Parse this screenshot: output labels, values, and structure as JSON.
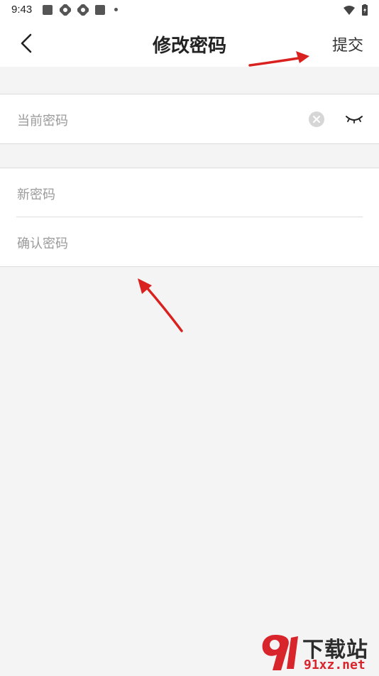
{
  "status_bar": {
    "time": "9:43"
  },
  "header": {
    "back_icon": "chevron-left-icon",
    "title": "修改密码",
    "submit_label": "提交"
  },
  "current_password_field": {
    "placeholder": "当前密码",
    "clear_icon": "clear-circle-icon",
    "visibility_icon": "eye-closed-icon"
  },
  "new_password_fields": [
    {
      "placeholder": "新密码"
    },
    {
      "placeholder": "确认密码"
    }
  ],
  "watermark": {
    "line1": "下载站",
    "line2": "91xz.net"
  },
  "colors": {
    "background": "#f4f4f4",
    "surface": "#ffffff",
    "placeholder": "#9a9a9a",
    "arrow": "#d9221f",
    "watermark_red": "#d8242b"
  }
}
